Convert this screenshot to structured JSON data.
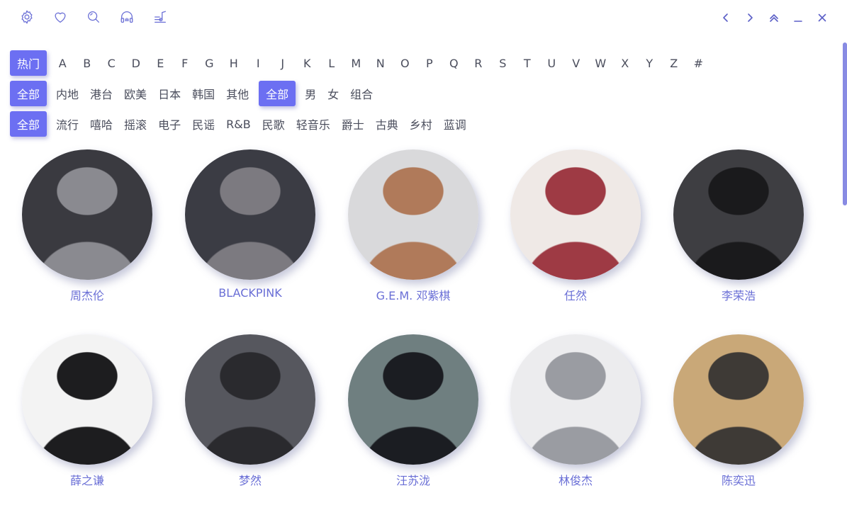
{
  "toolbar": {
    "left_icons": [
      "settings-icon",
      "heart-icon",
      "search-icon",
      "headphones-icon",
      "music-list-icon"
    ],
    "right_icons": [
      "back-icon",
      "forward-icon",
      "collapse-icon",
      "minimize-icon",
      "close-icon"
    ]
  },
  "filters": {
    "initials": {
      "hot_label": "热门",
      "letters": [
        "A",
        "B",
        "C",
        "D",
        "E",
        "F",
        "G",
        "H",
        "I",
        "J",
        "K",
        "L",
        "M",
        "N",
        "O",
        "P",
        "Q",
        "R",
        "S",
        "T",
        "U",
        "V",
        "W",
        "X",
        "Y",
        "Z",
        "#"
      ]
    },
    "region": [
      "全部",
      "内地",
      "港台",
      "欧美",
      "日本",
      "韩国",
      "其他"
    ],
    "gender": [
      "全部",
      "男",
      "女",
      "组合"
    ],
    "genre": [
      "全部",
      "流行",
      "嘻哈",
      "摇滚",
      "电子",
      "民谣",
      "R&B",
      "民歌",
      "轻音乐",
      "爵士",
      "古典",
      "乡村",
      "蓝调"
    ]
  },
  "artists": [
    {
      "name": "周杰伦",
      "palette": [
        "#3a3a40",
        "#8a8a90"
      ]
    },
    {
      "name": "BLACKPINK",
      "palette": [
        "#3b3c44",
        "#7c7a80"
      ]
    },
    {
      "name": "G.E.M. 邓紫棋",
      "palette": [
        "#d9d9db",
        "#b07a5a"
      ]
    },
    {
      "name": "任然",
      "palette": [
        "#efe9e6",
        "#9e3a44"
      ]
    },
    {
      "name": "李荣浩",
      "palette": [
        "#3e3e42",
        "#1a1a1c"
      ]
    },
    {
      "name": "薛之谦",
      "palette": [
        "#f3f3f3",
        "#1d1d1f"
      ]
    },
    {
      "name": "梦然",
      "palette": [
        "#56575e",
        "#2a2a2e"
      ]
    },
    {
      "name": "汪苏泷",
      "palette": [
        "#6f7f80",
        "#1b1d22"
      ]
    },
    {
      "name": "林俊杰",
      "palette": [
        "#ececee",
        "#9a9ca2"
      ]
    },
    {
      "name": "陈奕迅",
      "palette": [
        "#c9a878",
        "#3e3a36"
      ]
    }
  ],
  "colors": {
    "accent": "#6c6ff2",
    "artist_name": "#6a6fd6",
    "scrollbar": "#7b7ee0"
  }
}
